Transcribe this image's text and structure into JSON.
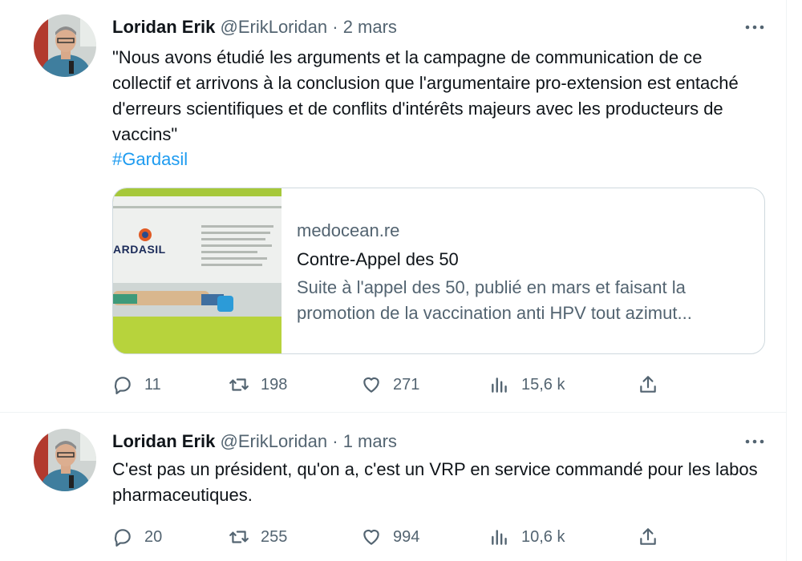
{
  "tweets": [
    {
      "name": "Loridan Erik",
      "handle": "@ErikLoridan",
      "separator": "·",
      "date": "2 mars",
      "text": "\"Nous avons étudié les arguments et la campagne de communication de ce collectif et arrivons à la conclusion que l'argumentaire pro-extension est entaché d'erreurs scientifiques et de conflits d'intérêts majeurs avec les producteurs de vaccins\"",
      "hashtag": "#Gardasil",
      "card": {
        "domain": "medocean.re",
        "title": "Contre-Appel des 50",
        "description": "Suite à l'appel des 50, publié en mars et faisant la promotion de la vaccination anti HPV tout azimut...",
        "image_text": "ARDASIL"
      },
      "actions": {
        "replies": "11",
        "retweets": "198",
        "likes": "271",
        "views": "15,6 k"
      }
    },
    {
      "name": "Loridan Erik",
      "handle": "@ErikLoridan",
      "separator": "·",
      "date": "1 mars",
      "text": "C'est pas un président, qu'on a, c'est un VRP en service commandé pour les labos pharmaceutiques.",
      "actions": {
        "replies": "20",
        "retweets": "255",
        "likes": "994",
        "views": "10,6 k"
      }
    }
  ],
  "icons": {
    "reply": "reply-icon",
    "retweet": "retweet-icon",
    "like": "heart-icon",
    "views": "views-icon",
    "share": "share-icon",
    "more": "more-icon"
  },
  "colors": {
    "link": "#1d9bf0",
    "muted": "#536471",
    "text": "#0f1419",
    "border": "#cfd9de"
  }
}
